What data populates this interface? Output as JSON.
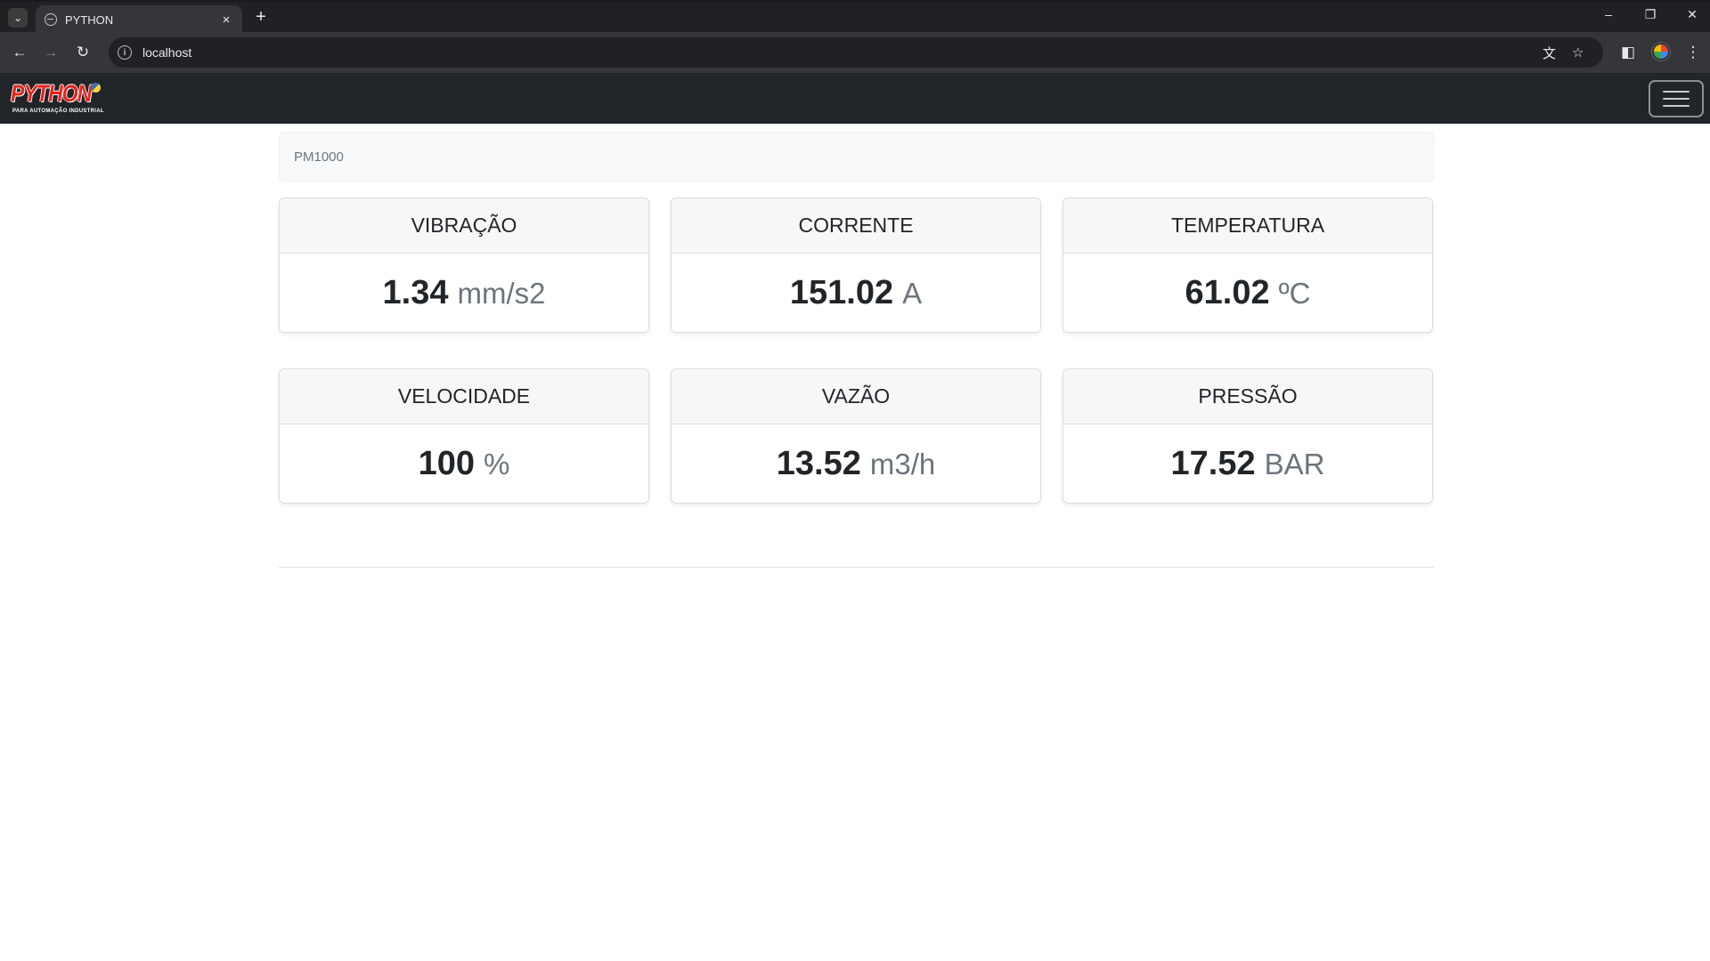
{
  "browser": {
    "tab_title": "PYTHON",
    "tab_close": "×",
    "new_tab": "+",
    "tab_search_icon": "⌄",
    "window_controls": {
      "minimize": "–",
      "restore": "❐",
      "close": "✕"
    },
    "nav": {
      "back": "←",
      "forward": "→",
      "reload": "↻"
    },
    "url": "localhost",
    "info_icon": "i",
    "translate_icon": "文",
    "bookmark_icon": "☆",
    "sidepanel_icon": "◧",
    "menu_icon": "⋮"
  },
  "app": {
    "brand": {
      "name": "PYTHON",
      "subtitle": "PARA AUTOMAÇÃO INDUSTRIAL"
    },
    "device": "PM1000",
    "metrics": [
      {
        "label": "VIBRAÇÃO",
        "value": "1.34",
        "unit": "mm/s2"
      },
      {
        "label": "CORRENTE",
        "value": "151.02",
        "unit": "A"
      },
      {
        "label": "TEMPERATURA",
        "value": "61.02",
        "unit": "ºC"
      },
      {
        "label": "VELOCIDADE",
        "value": "100",
        "unit": "%"
      },
      {
        "label": "VAZÃO",
        "value": "13.52",
        "unit": "m3/h"
      },
      {
        "label": "PRESSÃO",
        "value": "17.52",
        "unit": "BAR"
      }
    ]
  },
  "colors": {
    "navbar_bg": "#212529",
    "brand_red": "#e8231b",
    "card_header_bg": "#f7f7f7",
    "unit_gray": "#6c757d"
  }
}
